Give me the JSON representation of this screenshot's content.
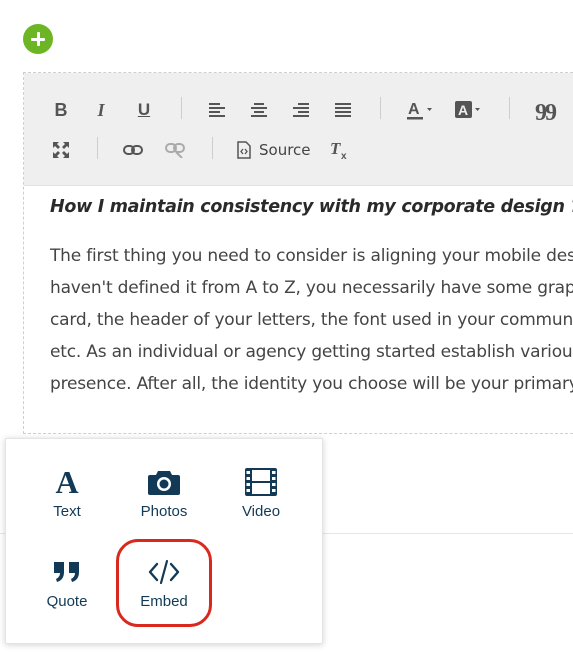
{
  "toolbar": {
    "bold_icon": "bold-icon",
    "italic_icon": "italic-icon",
    "underline_icon": "underline-icon",
    "bold_glyph": "B",
    "italic_glyph": "I",
    "underline_glyph": "U",
    "quote_glyph": "99",
    "source_label": "Source",
    "clear_format_glyph": "Tx"
  },
  "content": {
    "heading": "How I maintain consistency with my corporate design ?",
    "paragraph_lines": [
      "The first thing you need to consider is aligning your mobile des",
      "haven't defined it from A to Z, you necessarily have some graph",
      "card, the header of  your letters, the font used in your commun",
      "etc. As an individual or agency getting started establish various",
      "presence. After all, the identity you choose will be your primary"
    ]
  },
  "popup": {
    "items": [
      {
        "label": "Text",
        "icon": "text-icon"
      },
      {
        "label": "Photos",
        "icon": "camera-icon"
      },
      {
        "label": "Video",
        "icon": "film-icon"
      },
      {
        "label": "Quote",
        "icon": "quote-icon"
      },
      {
        "label": "Embed",
        "icon": "code-icon"
      }
    ]
  },
  "colors": {
    "add_button": "#6cb524",
    "popup_text": "#123a56",
    "highlight": "#d9281d",
    "toolbar_bg": "#efefef"
  }
}
